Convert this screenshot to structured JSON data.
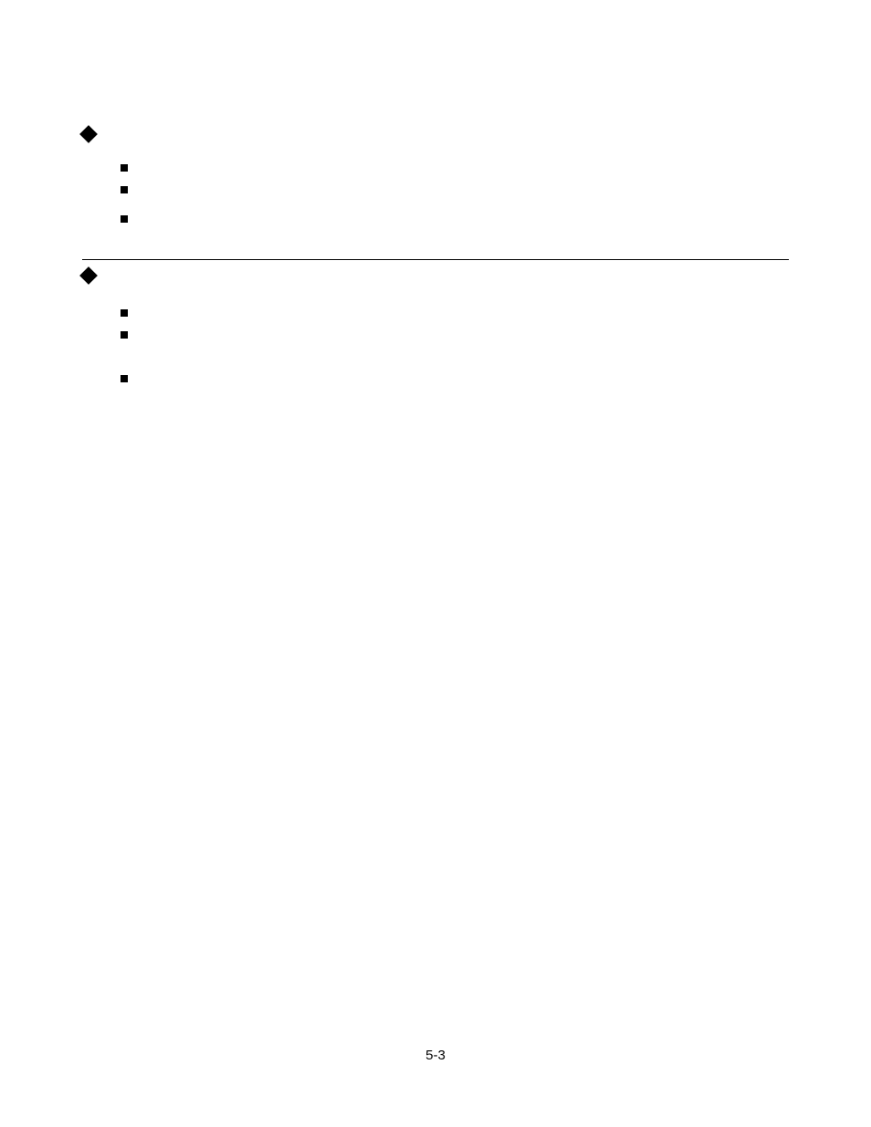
{
  "footer": {
    "page_number": "5-3"
  }
}
